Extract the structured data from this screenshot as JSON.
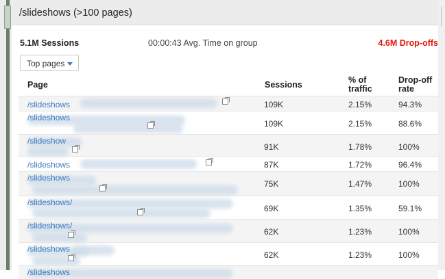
{
  "header": {
    "title": "/slideshows (>100 pages)"
  },
  "summary": {
    "sessions": "5.1M Sessions",
    "avg_time": "00:00:43 Avg. Time on group",
    "drop_offs": "4.6M Drop-offs"
  },
  "dropdown": {
    "selected": "Top pages"
  },
  "table": {
    "columns": [
      "Page",
      "Sessions",
      "% of traffic",
      "Drop-off rate"
    ],
    "rows": [
      {
        "page": "/slideshows",
        "sessions": "109K",
        "traffic": "2.15%",
        "drop": "94.3%"
      },
      {
        "page": "/slideshows",
        "sessions": "109K",
        "traffic": "2.15%",
        "drop": "88.6%"
      },
      {
        "page": "/slideshow",
        "sessions": "91K",
        "traffic": "1.78%",
        "drop": "100%"
      },
      {
        "page": "/slideshows",
        "sessions": "87K",
        "traffic": "1.72%",
        "drop": "96.4%"
      },
      {
        "page": "/slideshows",
        "sessions": "75K",
        "traffic": "1.47%",
        "drop": "100%"
      },
      {
        "page": "/slideshows/",
        "sessions": "69K",
        "traffic": "1.35%",
        "drop": "59.1%"
      },
      {
        "page": "/slideshows/",
        "sessions": "62K",
        "traffic": "1.23%",
        "drop": "100%"
      },
      {
        "page": "/slideshows",
        "sessions": "62K",
        "traffic": "1.23%",
        "drop": "100%"
      },
      {
        "page": "/slideshows",
        "sessions": "",
        "traffic": "",
        "drop": ""
      }
    ]
  },
  "colors": {
    "link": "#3d7cc2",
    "drop_offs": "#e3170a",
    "header_bg": "#ececec"
  },
  "icons": {
    "external_link": "external-link-icon",
    "dropdown_caret": "caret-down-icon"
  }
}
